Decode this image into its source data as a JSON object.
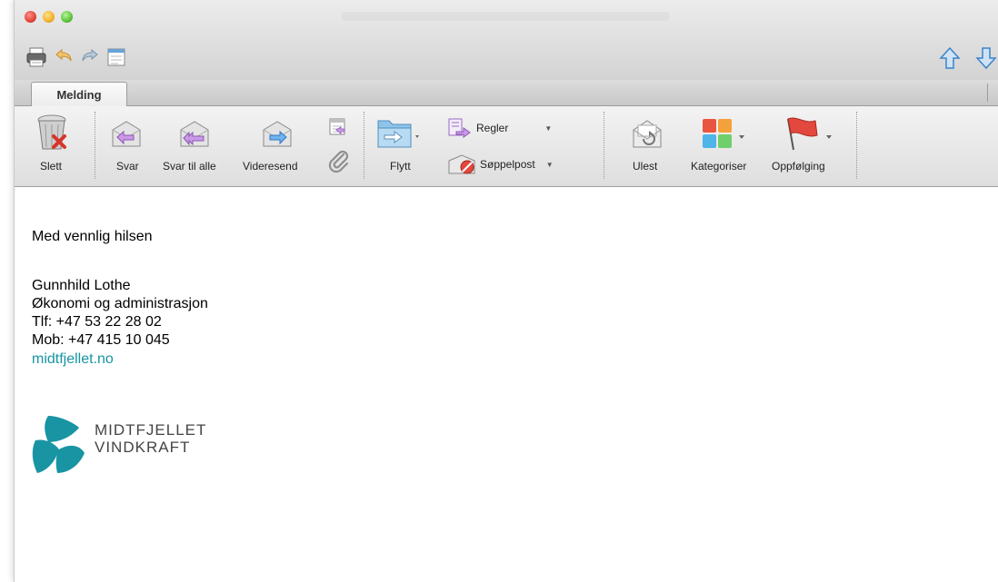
{
  "window": {
    "title": ""
  },
  "tabs": [
    {
      "label": "Melding"
    }
  ],
  "ribbon": {
    "delete_label": "Slett",
    "reply_label": "Svar",
    "reply_all_label": "Svar til alle",
    "forward_label": "Videresend",
    "move_label": "Flytt",
    "rules_label": "Regler",
    "junk_label": "Søppelpost",
    "unread_label": "Ulest",
    "categorize_label": "Kategoriser",
    "followup_label": "Oppfølging"
  },
  "message": {
    "greeting": "Med vennlig hilsen",
    "name": "Gunnhild Lothe",
    "department": "Økonomi og administrasjon",
    "phone": "Tlf: +47 53 22 28 02",
    "mobile": "Mob: +47 415 10 045",
    "website": "midtfjellet.no",
    "logo_line1": "MIDTFJELLET",
    "logo_line2": "VINDKRAFT"
  },
  "colors": {
    "link": "#1794a3",
    "logo": "#1894a3",
    "flag": "#e2483d"
  },
  "icons": [
    "print-icon",
    "undo-icon",
    "redo-icon",
    "calendar-icon",
    "up-arrow-icon",
    "down-arrow-icon",
    "trash-icon",
    "reply-icon",
    "reply-all-icon",
    "forward-icon",
    "attachment-icon",
    "folder-icon",
    "rules-icon",
    "junk-icon",
    "unread-icon",
    "categories-icon",
    "flag-icon"
  ]
}
